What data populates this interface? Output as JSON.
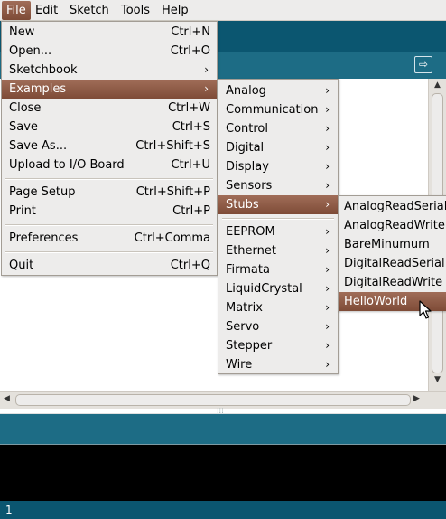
{
  "menubar": {
    "items": [
      "File",
      "Edit",
      "Sketch",
      "Tools",
      "Help"
    ],
    "active": "File"
  },
  "file_menu": {
    "new": {
      "label": "New",
      "accel": "Ctrl+N"
    },
    "open": {
      "label": "Open...",
      "accel": "Ctrl+O"
    },
    "sketchbook": {
      "label": "Sketchbook"
    },
    "examples": {
      "label": "Examples"
    },
    "close": {
      "label": "Close",
      "accel": "Ctrl+W"
    },
    "save": {
      "label": "Save",
      "accel": "Ctrl+S"
    },
    "save_as": {
      "label": "Save As...",
      "accel": "Ctrl+Shift+S"
    },
    "upload": {
      "label": "Upload to I/O Board",
      "accel": "Ctrl+U"
    },
    "page_setup": {
      "label": "Page Setup",
      "accel": "Ctrl+Shift+P"
    },
    "print": {
      "label": "Print",
      "accel": "Ctrl+P"
    },
    "preferences": {
      "label": "Preferences",
      "accel": "Ctrl+Comma"
    },
    "quit": {
      "label": "Quit",
      "accel": "Ctrl+Q"
    }
  },
  "examples_menu": {
    "items": [
      "Analog",
      "Communication",
      "Control",
      "Digital",
      "Display",
      "Sensors",
      "Stubs",
      "EEPROM",
      "Ethernet",
      "Firmata",
      "LiquidCrystal",
      "Matrix",
      "Servo",
      "Stepper",
      "Wire"
    ],
    "highlighted": "Stubs"
  },
  "stubs_menu": {
    "items": [
      "AnalogReadSerial",
      "AnalogReadWrite",
      "BareMinumum",
      "DigitalReadSerial",
      "DigitalReadWrite",
      "HelloWorld"
    ],
    "highlighted": "HelloWorld"
  },
  "submenu_arrow": "›",
  "status": {
    "line_number": "1"
  },
  "colors": {
    "toolbar": "#0b5670",
    "tabbar": "#1d6c85",
    "highlight": "#8a5641",
    "menu_bg": "#edeceb",
    "console": "#000000"
  },
  "icons": {
    "serial_monitor": "serial-monitor-icon",
    "cursor": "arrow-cursor-icon"
  }
}
